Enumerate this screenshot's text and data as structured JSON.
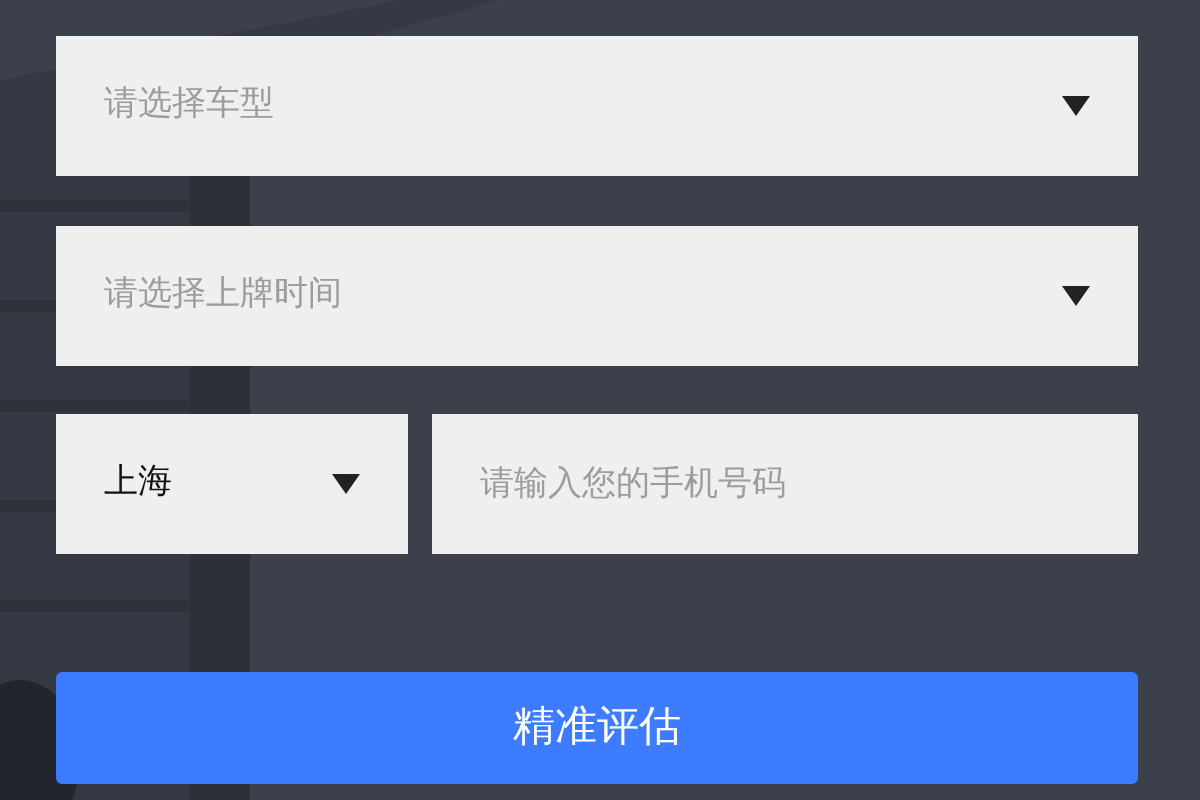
{
  "car_model": {
    "placeholder": "请选择车型"
  },
  "registration_date": {
    "placeholder": "请选择上牌时间"
  },
  "city": {
    "value": "上海"
  },
  "phone": {
    "placeholder": "请输入您的手机号码"
  },
  "submit_button": {
    "label": "精准评估"
  }
}
